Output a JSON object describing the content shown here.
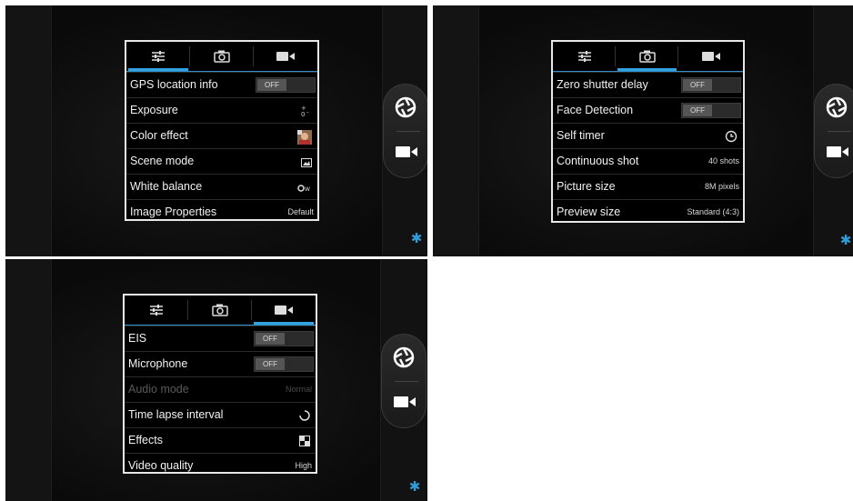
{
  "screens": [
    {
      "active_tab": "settings",
      "rows": [
        {
          "label": "GPS location info",
          "toggle": "OFF"
        },
        {
          "label": "Exposure",
          "icon": "exposure-icon"
        },
        {
          "label": "Color effect",
          "icon": "color-effect-thumbnail"
        },
        {
          "label": "Scene mode",
          "icon": "scene-mode-icon"
        },
        {
          "label": "White balance",
          "icon": "white-balance-auto-icon"
        },
        {
          "label": "Image Properties",
          "value": "Default"
        }
      ]
    },
    {
      "active_tab": "camera",
      "rows": [
        {
          "label": "Zero shutter delay",
          "toggle": "OFF"
        },
        {
          "label": "Face Detection",
          "toggle": "OFF"
        },
        {
          "label": "Self timer",
          "icon": "timer-icon"
        },
        {
          "label": "Continuous shot",
          "value": "40 shots"
        },
        {
          "label": "Picture size",
          "value": "8M pixels"
        },
        {
          "label": "Preview size",
          "value": "Standard (4:3)"
        }
      ]
    },
    {
      "active_tab": "video",
      "rows": [
        {
          "label": "EIS",
          "toggle": "OFF"
        },
        {
          "label": "Microphone",
          "toggle": "OFF"
        },
        {
          "label": "Audio mode",
          "value": "Normal",
          "disabled": true
        },
        {
          "label": "Time lapse interval",
          "icon": "time-lapse-icon"
        },
        {
          "label": "Effects",
          "icon": "effects-icon"
        },
        {
          "label": "Video quality",
          "value": "High"
        }
      ]
    }
  ],
  "tabs": [
    {
      "name": "settings",
      "icon": "sliders-icon"
    },
    {
      "name": "camera",
      "icon": "camera-icon"
    },
    {
      "name": "video",
      "icon": "video-camera-icon"
    }
  ],
  "colors": {
    "accent": "#33a3e0",
    "panel_border": "#e8e8e8",
    "background": "#0d0d0d"
  }
}
